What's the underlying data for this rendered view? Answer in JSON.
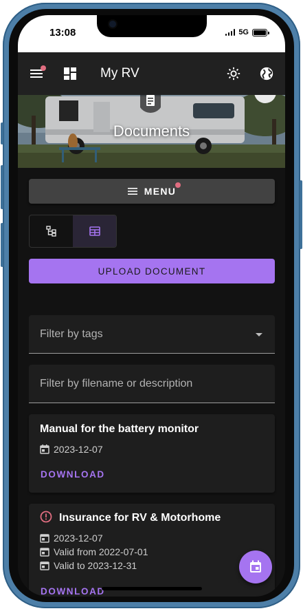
{
  "status_bar": {
    "time": "13:08",
    "network": "5G"
  },
  "app_bar": {
    "title": "My RV"
  },
  "hero": {
    "title": "Documents"
  },
  "menu_button": {
    "label": "MENU"
  },
  "upload_button": {
    "label": "UPLOAD DOCUMENT"
  },
  "filters": {
    "tags_placeholder": "Filter by tags",
    "text_placeholder": "Filter by filename or description"
  },
  "documents": [
    {
      "title": "Manual for the battery monitor",
      "date": "2023-12-07",
      "download_label": "DOWNLOAD"
    },
    {
      "title": "Insurance for RV & Motorhome",
      "date": "2023-12-07",
      "valid_from": "Valid from 2022-07-01",
      "valid_to": "Valid to 2023-12-31",
      "download_label": "DOWNLOAD",
      "warning": true
    }
  ],
  "colors": {
    "accent": "#a574f0",
    "badge": "#e06d80",
    "surface": "#1e1e1e",
    "app_bar": "#212121"
  }
}
